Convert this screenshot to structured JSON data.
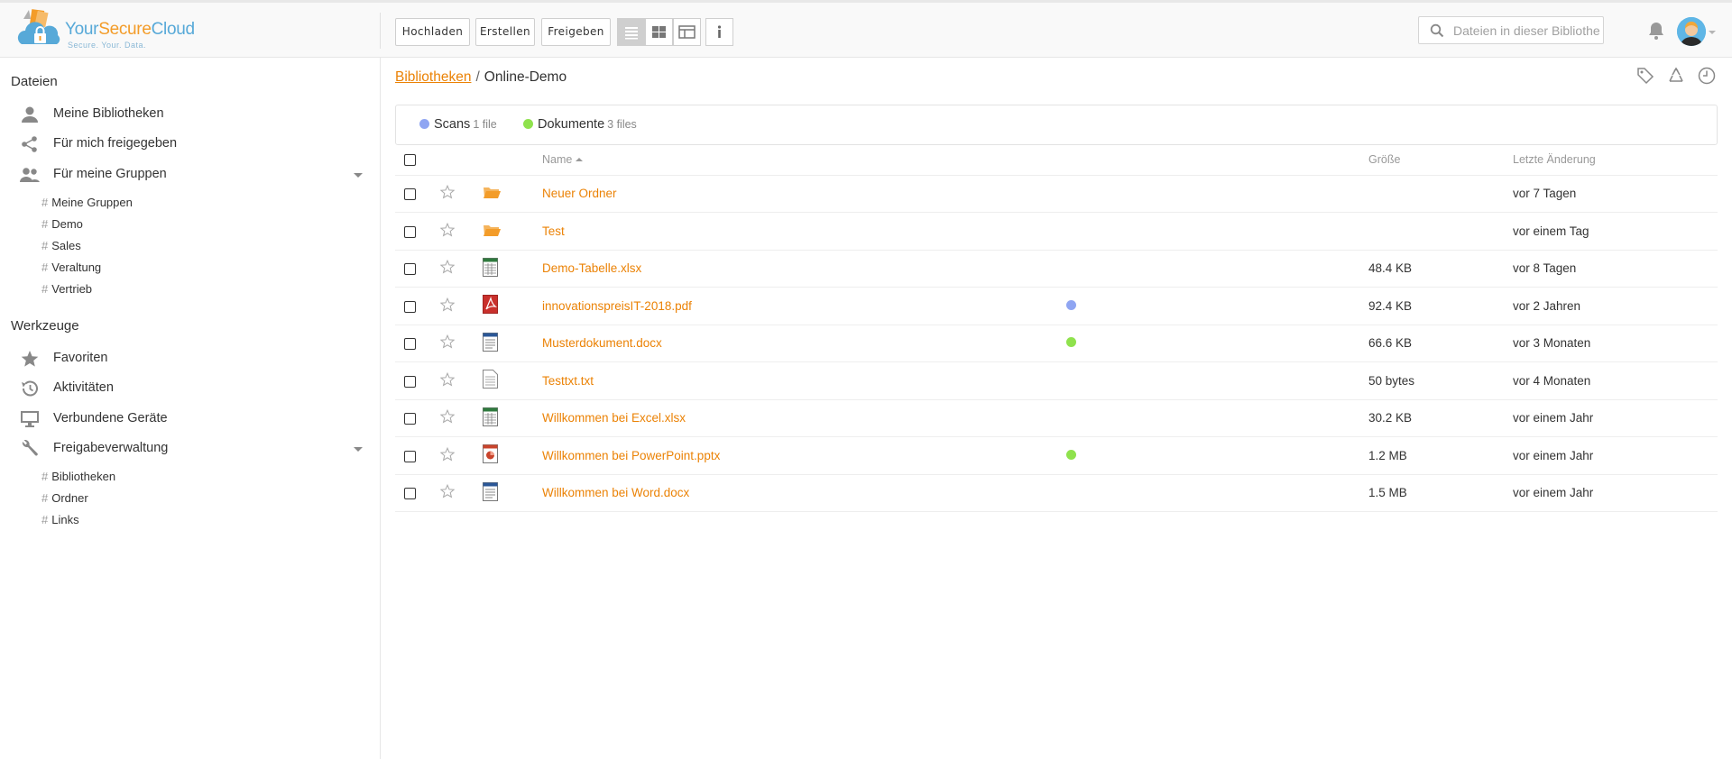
{
  "app": {
    "logo_part1": "Your",
    "logo_part2": "Secure",
    "logo_part3": "Cloud",
    "slogan": "Secure. Your. Data."
  },
  "toolbar": {
    "upload_label": "Hochladen",
    "create_label": "Erstellen",
    "share_label": "Freigeben"
  },
  "search": {
    "placeholder": "Dateien in dieser Bibliothek"
  },
  "sidebar": {
    "files_heading": "Dateien",
    "files_items": [
      {
        "label": "Meine Bibliotheken",
        "icon": "user-icon"
      },
      {
        "label": "Für mich freigegeben",
        "icon": "share-icon"
      },
      {
        "label": "Für meine Gruppen",
        "icon": "group-icon"
      }
    ],
    "groups": [
      "Meine Gruppen",
      "Demo",
      "Sales",
      "Veraltung",
      "Vertrieb"
    ],
    "tools_heading": "Werkzeuge",
    "tools_items": [
      {
        "label": "Favoriten",
        "icon": "star-icon"
      },
      {
        "label": "Aktivitäten",
        "icon": "history-icon"
      },
      {
        "label": "Verbundene Geräte",
        "icon": "monitor-icon"
      },
      {
        "label": "Freigabeverwaltung",
        "icon": "wrench-icon"
      }
    ],
    "share_admin": [
      "Bibliotheken",
      "Ordner",
      "Links"
    ],
    "hash": "#"
  },
  "breadcrumb": {
    "root": "Bibliotheken",
    "separator": "/",
    "current": "Online-Demo"
  },
  "tags": [
    {
      "name": "Scans",
      "count": "1 file",
      "color": "#8fa5f2"
    },
    {
      "name": "Dokumente",
      "count": "3 files",
      "color": "#8fe24d"
    }
  ],
  "table": {
    "headers": {
      "name": "Name",
      "size": "Größe",
      "modified": "Letzte Änderung"
    },
    "rows": [
      {
        "name": "Neuer Ordner",
        "type": "folder",
        "tag": "",
        "size": "",
        "modified": "vor 7 Tagen"
      },
      {
        "name": "Test",
        "type": "folder",
        "tag": "",
        "size": "",
        "modified": "vor einem Tag"
      },
      {
        "name": "Demo-Tabelle.xlsx",
        "type": "excel",
        "tag": "",
        "size": "48.4 KB",
        "modified": "vor 8 Tagen"
      },
      {
        "name": "innovationspreisIT-2018.pdf",
        "type": "pdf",
        "tag": "#8fa5f2",
        "size": "92.4 KB",
        "modified": "vor 2 Jahren"
      },
      {
        "name": "Musterdokument.docx",
        "type": "word",
        "tag": "#8fe24d",
        "size": "66.6 KB",
        "modified": "vor 3 Monaten"
      },
      {
        "name": "Testtxt.txt",
        "type": "txt",
        "tag": "",
        "size": "50 bytes",
        "modified": "vor 4 Monaten"
      },
      {
        "name": "Willkommen bei Excel.xlsx",
        "type": "excel",
        "tag": "",
        "size": "30.2 KB",
        "modified": "vor einem Jahr"
      },
      {
        "name": "Willkommen bei PowerPoint.pptx",
        "type": "ppt",
        "tag": "#8fe24d",
        "size": "1.2 MB",
        "modified": "vor einem Jahr"
      },
      {
        "name": "Willkommen bei Word.docx",
        "type": "word",
        "tag": "",
        "size": "1.5 MB",
        "modified": "vor einem Jahr"
      }
    ]
  },
  "colors": {
    "accent": "#eb8205",
    "logo_blue": "#57a9d8",
    "logo_orange": "#f39c29"
  }
}
